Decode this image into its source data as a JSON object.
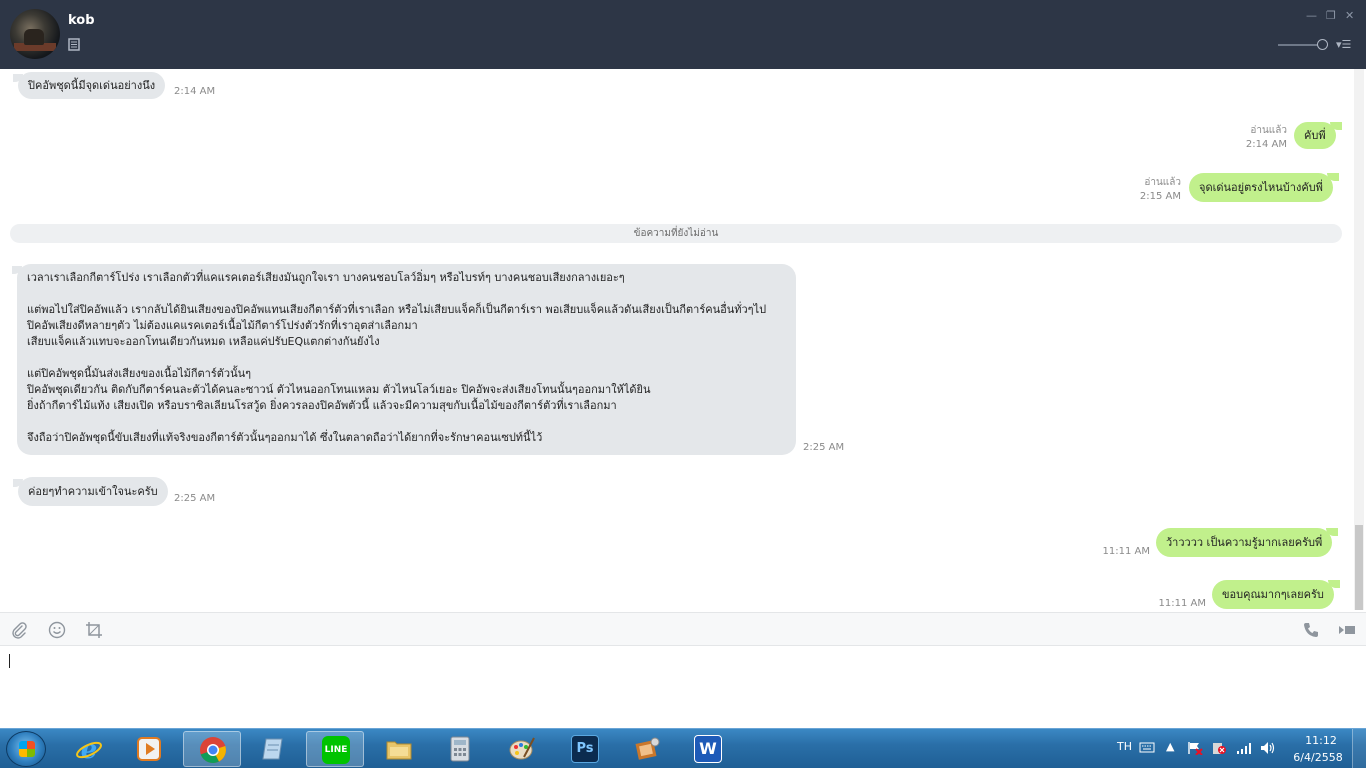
{
  "header": {
    "contact_name": "kob",
    "minimize": "—",
    "restore": "❐",
    "close": "✕"
  },
  "messages": {
    "m1": {
      "text": "ปิคอัพชุดนี้มีจุดเด่นอย่างนึง",
      "time": "2:14 AM"
    },
    "m2": {
      "text": "คับพี่",
      "read": "อ่านแล้ว",
      "time": "2:14 AM"
    },
    "m3": {
      "text": "จุดเด่นอยู่ตรงไหนบ้างคับพี่",
      "read": "อ่านแล้ว",
      "time": "2:15 AM"
    },
    "divider": "ข้อความที่ยังไม่อ่าน",
    "m4": {
      "lines": [
        "เวลาเราเลือกกีตาร์โปร่ง เราเลือกตัวที่แคแรคเตอร์เสียงมันถูกใจเรา บางคนชอบโลว์อิ่มๆ หรือไบรท์ๆ บางคนชอบเสียงกลางเยอะๆ",
        "",
        "แต่พอไปใส่ปิคอัพแล้ว เรากลับได้ยินเสียงของปิคอัพแทนเสียงกีตาร์ตัวที่เราเลือก หรือไม่เสียบแจ็คก็เป็นกีตาร์เรา พอเสียบแจ็คแล้วดันเสียงเป็นกีตาร์คนอื่นทั่วๆไป",
        "ปิคอัพเสียงดีหลายๆตัว ไม่ต้องแคแรคเตอร์เนื้อไม้กีตาร์โปร่งตัวรักที่เราอุตส่าเลือกมา",
        "เสียบแจ็คแล้วแทบจะออกโทนเดียวกันหมด เหลือแค่ปรับEQแตกต่างกันยังไง",
        "",
        "แต่ปิคอัพชุดนี้มันส่งเสียงของเนื้อไม้กีตาร์ตัวนั้นๆ",
        "ปิคอัพชุดเดียวกัน ติดกับกีตาร์คนละตัวได้คนละซาวน์ ตัวไหนออกโทนแหลม  ตัวไหนโลว์เยอะ ปิคอัพจะส่งเสียงโทนนั้นๆออกมาให้ได้ยิน",
        "ยิ่งถ้ากีตาร์ไม้แท้ง เสียงเปิด หรือบราซิลเลียนโรสวู้ด ยิ่งควรลองปิคอัพตัวนี้ แล้วจะมีความสุขกับเนื้อไม้ของกีตาร์ตัวที่เราเลือกมา",
        "",
        "จึงถือว่าปิคอัพชุดนี้ขับเสียงที่แท้จริงของกีตาร์ตัวนั้นๆออกมาได้ ซึ่งในตลาดถือว่าได้ยากที่จะรักษาคอนเซปท์นี้ไว้"
      ],
      "time": "2:25 AM"
    },
    "m5": {
      "text": "ค่อยๆทำความเข้าใจนะครับ",
      "time": "2:25 AM"
    },
    "m6": {
      "text": "ว้าวววว  เป็นความรู้มากเลยครับพี่",
      "time": "11:11 AM"
    },
    "m7": {
      "text": "ขอบคุณมากๆเลยครับ",
      "time": "11:11 AM"
    }
  },
  "toolbar": {
    "icons": [
      "paperclip-icon",
      "emoji-icon",
      "crop-icon",
      "phone-icon",
      "video-icon"
    ]
  },
  "taskbar": {
    "apps": [
      "internet-explorer",
      "media-player",
      "chrome",
      "notepad",
      "line",
      "file-explorer",
      "calculator",
      "paint",
      "photoshop",
      "movie-maker",
      "word"
    ],
    "line_label": "LINE",
    "ps_label": "Ps",
    "word_label": "W",
    "lang": "TH",
    "time": "11:12",
    "date": "6/4/2558"
  },
  "colors": {
    "header_bg": "#2d3646",
    "sent_bubble": "#c1f08c",
    "recv_bubble": "#e4e7ea",
    "taskbar": "#2a6fa8"
  }
}
